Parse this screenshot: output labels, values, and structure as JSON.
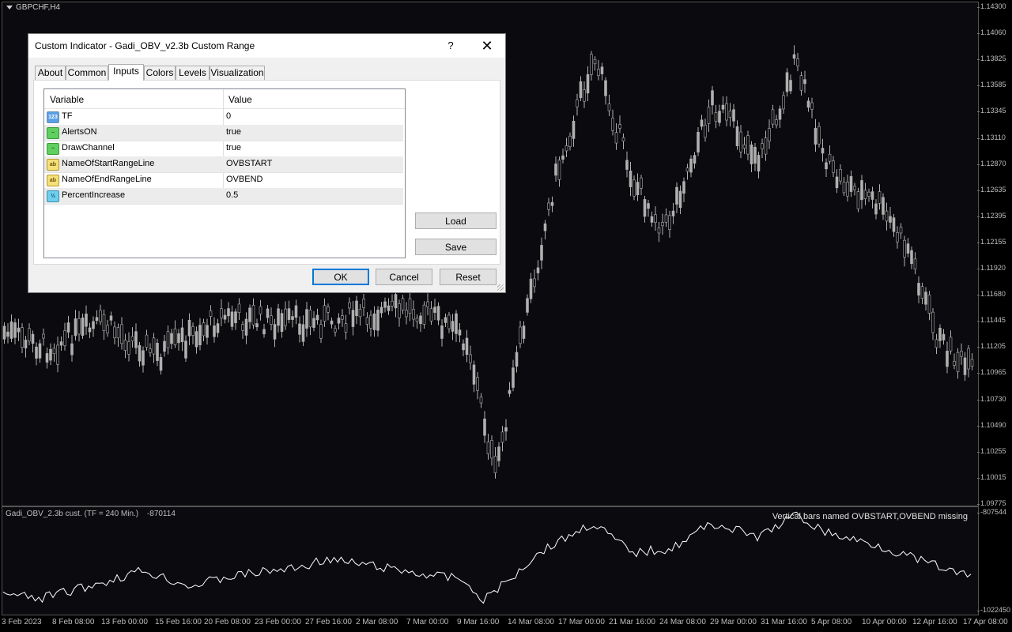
{
  "chart": {
    "symbol": "GBPCHF,H4",
    "colors": {
      "background": "#0b0b0f",
      "candle": "#b0b0b0",
      "line": "#ffffff"
    },
    "price_ticks": [
      "1.14300",
      "1.14060",
      "1.13825",
      "1.13585",
      "1.13345",
      "1.13110",
      "1.12870",
      "1.12635",
      "1.12395",
      "1.12155",
      "1.11920",
      "1.11680",
      "1.11445",
      "1.11205",
      "1.10965",
      "1.10730",
      "1.10490",
      "1.10255",
      "1.10015",
      "1.09775"
    ],
    "time_ticks": [
      "3 Feb 2023",
      "8 Feb 08:00",
      "13 Feb 00:00",
      "15 Feb 16:00",
      "20 Feb 08:00",
      "23 Feb 00:00",
      "27 Feb 16:00",
      "2 Mar 08:00",
      "7 Mar 00:00",
      "9 Mar 16:00",
      "14 Mar 08:00",
      "17 Mar 00:00",
      "21 Mar 16:00",
      "24 Mar 08:00",
      "29 Mar 00:00",
      "31 Mar 16:00",
      "5 Apr 08:00",
      "10 Apr 00:00",
      "12 Apr 16:00",
      "17 Apr 08:00"
    ],
    "indicator": {
      "label": "Gadi_OBV_2.3b cust. (TF = 240 Min.)",
      "value": "-870114",
      "message": "Vertical bars named OVBSTART,OVBEND missing",
      "axis_top": "-807544",
      "axis_bottom": "-1022450"
    }
  },
  "dialog": {
    "title": "Custom Indicator - Gadi_OBV_v2.3b Custom Range",
    "help": "?",
    "close": "✕",
    "tabs": [
      "About",
      "Common",
      "Inputs",
      "Colors",
      "Levels",
      "Visualization"
    ],
    "active_tab": "Inputs",
    "grid_headers": {
      "variable": "Variable",
      "value": "Value"
    },
    "rows": [
      {
        "type": "int",
        "icon_text": "123",
        "variable": "TF",
        "value": "0"
      },
      {
        "type": "bool",
        "icon_text": "~",
        "variable": "AlertsON",
        "value": "true"
      },
      {
        "type": "bool",
        "icon_text": "~",
        "variable": "DrawChannel",
        "value": "true"
      },
      {
        "type": "str",
        "icon_text": "ab",
        "variable": "NameOfStartRangeLine",
        "value": "OVBSTART"
      },
      {
        "type": "str",
        "icon_text": "ab",
        "variable": "NameOfEndRangeLine",
        "value": "OVBEND"
      },
      {
        "type": "dbl",
        "icon_text": "½",
        "variable": "PercentIncrease",
        "value": "0.5"
      }
    ],
    "load_label": "Load",
    "save_label": "Save",
    "ok_label": "OK",
    "cancel_label": "Cancel",
    "reset_label": "Reset"
  }
}
